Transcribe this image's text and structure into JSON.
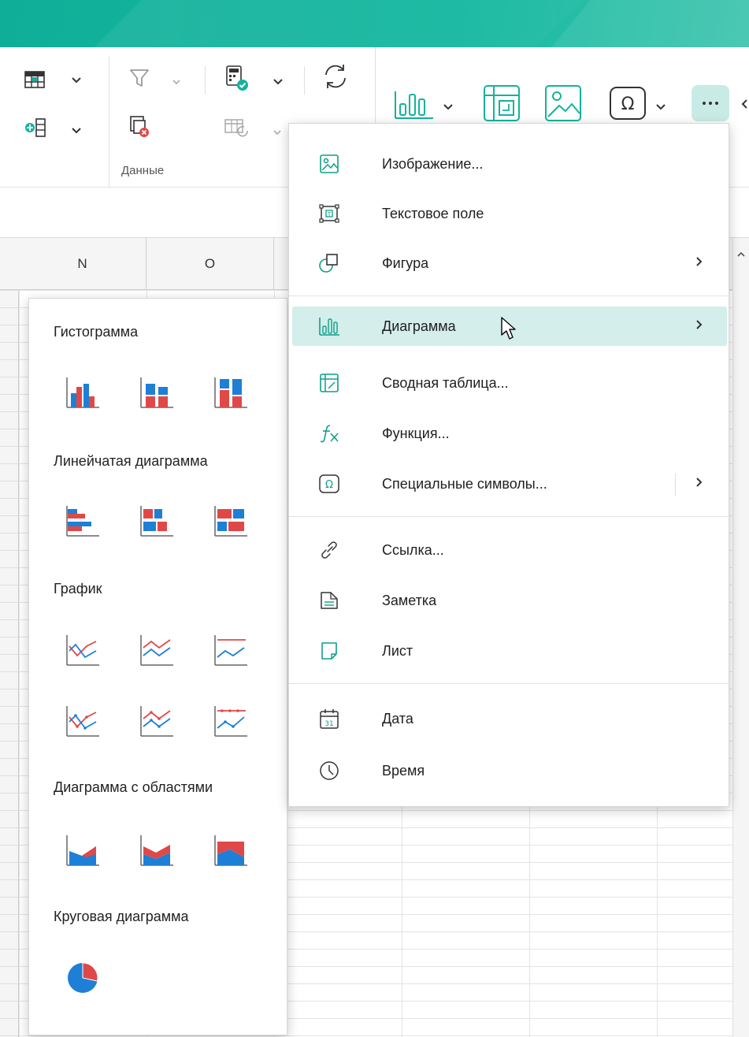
{
  "colors": {
    "accent": "#13b39c",
    "active_bg": "#d4eeeb",
    "red": "#e04848",
    "blue": "#1e7fd6"
  },
  "ribbon": {
    "group_label": "Данные",
    "icons": [
      "table-icon",
      "insert-column-icon",
      "filter-icon",
      "clear-filter-icon",
      "calculator-icon",
      "recalc-table-icon",
      "refresh-icon",
      "chart-icon",
      "pivot-table-icon",
      "image-icon",
      "omega-icon",
      "more-icon"
    ]
  },
  "columns": [
    "N",
    "O"
  ],
  "insert_menu": {
    "items": [
      {
        "label": "Изображение...",
        "icon": "image-icon"
      },
      {
        "label": "Текстовое поле",
        "icon": "text-field-icon"
      },
      {
        "label": "Фигура",
        "icon": "shape-icon",
        "submenu": true
      },
      {
        "label": "Диаграмма",
        "icon": "chart-icon",
        "submenu": true,
        "active": true
      },
      {
        "label": "Сводная таблица...",
        "icon": "pivot-table-icon"
      },
      {
        "label": "Функция...",
        "icon": "function-icon"
      },
      {
        "label": "Специальные символы...",
        "icon": "omega-icon",
        "submenu": true
      },
      {
        "label": "Ссылка...",
        "icon": "link-icon"
      },
      {
        "label": "Заметка",
        "icon": "note-icon"
      },
      {
        "label": "Лист",
        "icon": "sheet-icon"
      },
      {
        "label": "Дата",
        "icon": "calendar-icon"
      },
      {
        "label": "Время",
        "icon": "clock-icon"
      }
    ],
    "calendar_day": "31"
  },
  "chart_menu": {
    "sections": [
      {
        "title": "Гистограмма"
      },
      {
        "title": "Линейчатая диаграмма"
      },
      {
        "title": "График"
      },
      {
        "title": "Диаграмма с областями"
      },
      {
        "title": "Круговая диаграмма"
      }
    ]
  }
}
